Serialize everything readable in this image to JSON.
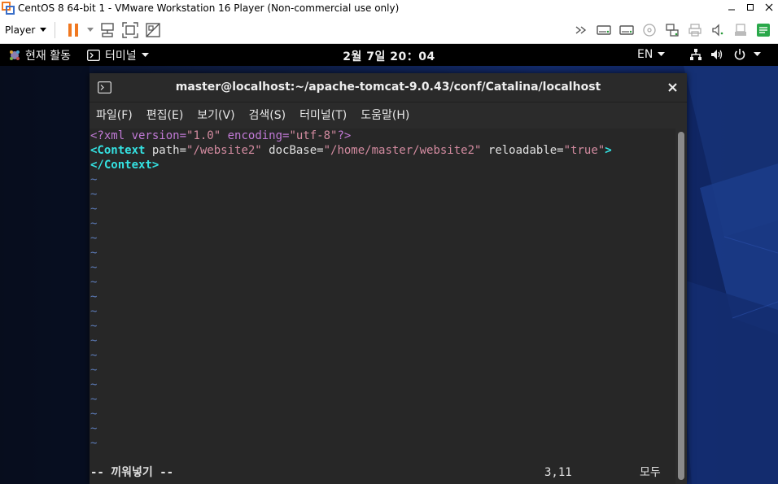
{
  "vmware": {
    "window_title": "CentOS 8 64-bit 1 - VMware Workstation 16 Player (Non-commercial use only)",
    "player_label": "Player",
    "colors": {
      "pause_accent": "#f07820",
      "icon_gray": "#555555"
    }
  },
  "gnome": {
    "activities": "현재 활동",
    "app_menu": "터미널",
    "clock": "2월 7일  20：04",
    "lang": "EN"
  },
  "terminal": {
    "title": "master@localhost:~/apache-tomcat-9.0.43/conf/Catalina/localhost",
    "menu": [
      "파일(F)",
      "편집(E)",
      "보기(V)",
      "검색(S)",
      "터미널(T)",
      "도움말(H)"
    ],
    "line1": {
      "open": "<?xml version=",
      "v1": "\"1.0\"",
      "mid": " encoding=",
      "v2": "\"utf-8\"",
      "close": "?>"
    },
    "line2": {
      "open": "<Context",
      "a1": " path=",
      "v1": "\"/website2\"",
      "a2": " docBase=",
      "v2": "\"/home/master/website2\"",
      "a3": " reloadable=",
      "v3": "\"true\"",
      "close": ">"
    },
    "line3": "</Context>",
    "tilde": "~",
    "status_mode": "-- 끼워넣기 --",
    "status_pos": "3,11",
    "status_scroll": "모두"
  }
}
